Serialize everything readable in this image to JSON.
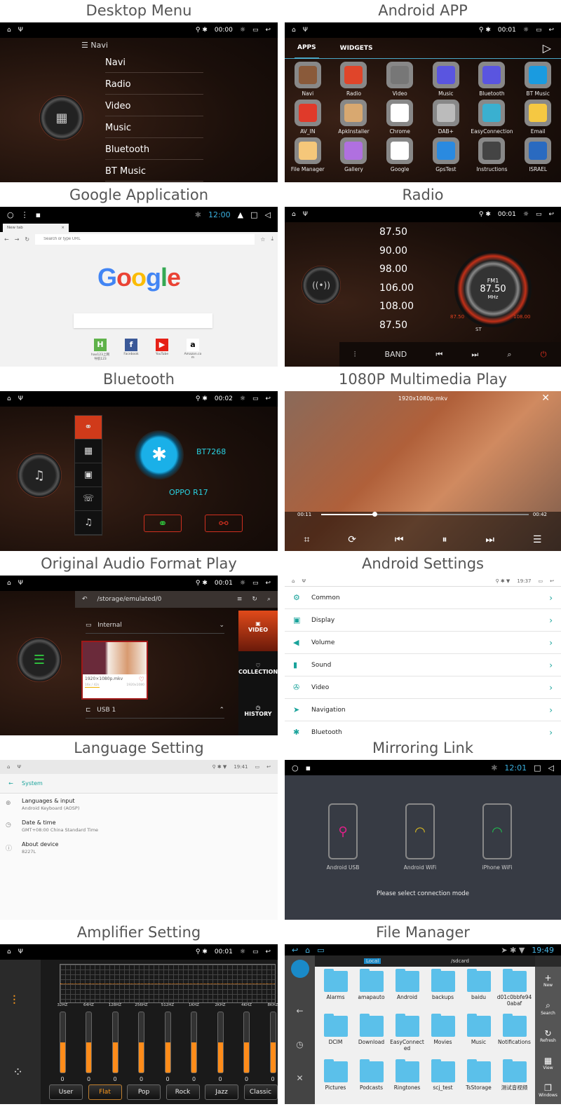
{
  "titles": [
    "Desktop Menu",
    "Android APP",
    "Google Application",
    "Radio",
    "Bluetooth",
    "1080P Multimedia Play",
    "Original Audio Format Play",
    "Android Settings",
    "Language Setting",
    "Mirroring Link",
    "Amplifier Setting",
    "File Manager"
  ],
  "colors": {
    "accent_orange": "#ff8c1a",
    "accent_red": "#c8301a",
    "teal": "#1aa39b",
    "bt_blue": "#1ab0e8",
    "folder_blue": "#5bc0ea"
  },
  "desktop": {
    "time": "00:00",
    "header": "Navi",
    "items": [
      "Navi",
      "Radio",
      "Video",
      "Music",
      "Bluetooth",
      "BT Music"
    ]
  },
  "apps": {
    "time": "00:01",
    "tabs": [
      "APPS",
      "WIDGETS"
    ],
    "active_tab": "APPS",
    "items": [
      {
        "label": "Navi",
        "color": "#8a5a3a"
      },
      {
        "label": "Radio",
        "color": "#e0452a"
      },
      {
        "label": "Video",
        "color": "#777777"
      },
      {
        "label": "Music",
        "color": "#5a55e0"
      },
      {
        "label": "Bluetooth",
        "color": "#5a55e0"
      },
      {
        "label": "BT Music",
        "color": "#1a9be0"
      },
      {
        "label": "AV_IN",
        "color": "#e03a2a"
      },
      {
        "label": "ApkInstaller",
        "color": "#d8a870"
      },
      {
        "label": "Chrome",
        "color": "#ffffff"
      },
      {
        "label": "DAB+",
        "color": "#bbbbbb"
      },
      {
        "label": "EasyConnection",
        "color": "#3ab0d0"
      },
      {
        "label": "Email",
        "color": "#f5c842"
      },
      {
        "label": "File Manager",
        "color": "#f5c77a"
      },
      {
        "label": "Gallery",
        "color": "#b070e0"
      },
      {
        "label": "Google",
        "color": "#ffffff"
      },
      {
        "label": "GpsTest",
        "color": "#2a8ae0"
      },
      {
        "label": "Instructions",
        "color": "#444444"
      },
      {
        "label": "ISRAEL",
        "color": "#2a6ac0"
      }
    ]
  },
  "google": {
    "time": "12:00",
    "tab_label": "New tab",
    "url_placeholder": "Search or type URL",
    "logo": "Google",
    "shortcuts": [
      {
        "label": "hao123上网导航123",
        "letter": "H",
        "color": "#5fb24a"
      },
      {
        "label": "Facebook",
        "letter": "f",
        "color": "#3b5998"
      },
      {
        "label": "YouTube",
        "letter": "▶",
        "color": "#e62117"
      },
      {
        "label": "Amazon.com",
        "letter": "a",
        "color": "#ffffff"
      }
    ]
  },
  "radio": {
    "time": "00:01",
    "presets": [
      "87.50",
      "90.00",
      "98.00",
      "106.00",
      "108.00",
      "87.50"
    ],
    "band": "FM1",
    "frequency": "87.50",
    "unit": "MHz",
    "min": "87.50",
    "max": "108.00",
    "stereo": "ST",
    "controls": {
      "band": "BAND"
    }
  },
  "bluetooth": {
    "time": "00:02",
    "device_name": "BT7268",
    "paired_device": "OPPO R17"
  },
  "video": {
    "filename": "1920x1080p.mkv",
    "elapsed": "00:11",
    "duration": "00:42",
    "progress_pct": 26
  },
  "audio": {
    "time": "00:01",
    "path": "/storage/emulated/0",
    "storage_internal": "Internal",
    "file_name": "1920×1080p.mkv",
    "file_progress": "16s / 42s",
    "file_resolution": "1920x1080",
    "storage_usb": "USB 1",
    "tabs": [
      "VIDEO",
      "COLLECTION",
      "HISTORY"
    ],
    "active_tab": "VIDEO"
  },
  "settings": {
    "time": "19:37",
    "items": [
      {
        "label": "Common",
        "icon": "⚙"
      },
      {
        "label": "Display",
        "icon": "▣"
      },
      {
        "label": "Volume",
        "icon": "◀"
      },
      {
        "label": "Sound",
        "icon": "▮"
      },
      {
        "label": "Video",
        "icon": "✇"
      },
      {
        "label": "Navigation",
        "icon": "➤"
      },
      {
        "label": "Bluetooth",
        "icon": "✱"
      }
    ]
  },
  "language": {
    "time": "19:41",
    "header": "System",
    "items": [
      {
        "label": "Languages & input",
        "sub": "Android Keyboard (AOSP)",
        "icon": "⊕"
      },
      {
        "label": "Date & time",
        "sub": "GMT+08:00 China Standard Time",
        "icon": "◷"
      },
      {
        "label": "About device",
        "sub": "8227L",
        "icon": "ⓘ"
      }
    ]
  },
  "mirroring": {
    "time": "12:01",
    "modes": [
      {
        "label": "Android USB",
        "icon": "⚲",
        "color": "#e0208a"
      },
      {
        "label": "Android WiFi",
        "icon": "◠",
        "color": "#e0c020"
      },
      {
        "label": "iPhone WiFi",
        "icon": "◠",
        "color": "#20c050"
      }
    ],
    "prompt": "Please select connection mode"
  },
  "amplifier": {
    "time": "00:01",
    "bands": [
      {
        "label": "32HZ",
        "value": "0"
      },
      {
        "label": "64HZ",
        "value": "0"
      },
      {
        "label": "128HZ",
        "value": "0"
      },
      {
        "label": "256HZ",
        "value": "0"
      },
      {
        "label": "512HZ",
        "value": "0"
      },
      {
        "label": "1KHZ",
        "value": "0"
      },
      {
        "label": "2KHZ",
        "value": "0"
      },
      {
        "label": "4KHZ",
        "value": "0"
      },
      {
        "label": "8KHZ",
        "value": "0"
      }
    ],
    "level_fraction": 0.5,
    "presets": [
      "User",
      "Flat",
      "Pop",
      "Rock",
      "Jazz",
      "Classic"
    ],
    "active_preset": "Flat"
  },
  "filemanager": {
    "time": "19:49",
    "location": "Local",
    "path": "/sdcard",
    "folders": [
      "Alarms",
      "amapauto",
      "Android",
      "backups",
      "baidu",
      "d01c0bbfe940abaf",
      "DCIM",
      "Download",
      "EasyConnected",
      "Movies",
      "Music",
      "Notifications",
      "Pictures",
      "Podcasts",
      "Ringtones",
      "scj_test",
      "TsStorage",
      "测试音视频"
    ],
    "actions": [
      "New",
      "Search",
      "Refresh",
      "View",
      "Windows"
    ]
  }
}
